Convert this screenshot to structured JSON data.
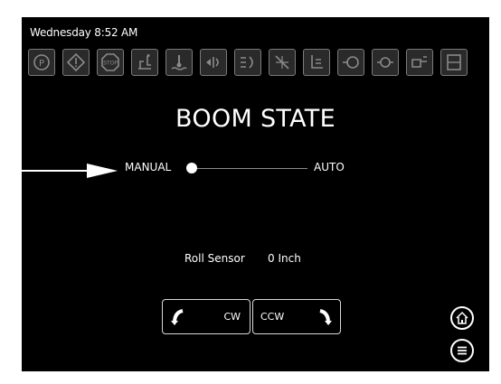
{
  "header": {
    "datetime": "Wednesday 8:52 AM"
  },
  "status_icons": [
    "parking-brake-icon",
    "warning-icon",
    "stop-icon",
    "seat-operator-icon",
    "water-temp-icon",
    "left-turn-icon",
    "hazard-icon",
    "no-fan-icon",
    "hydraulic-icon",
    "right-arrow-gauge-icon",
    "engine-icon",
    "fuel-nozzle-icon",
    "fuel-level-icon"
  ],
  "title": "BOOM STATE",
  "mode": {
    "manual_label": "MANUAL",
    "auto_label": "AUTO",
    "selected": "MANUAL"
  },
  "roll_sensor": {
    "label": "Roll Sensor",
    "value": "0 Inch"
  },
  "buttons": {
    "cw_label": "CW",
    "ccw_label": "CCW"
  },
  "colors": {
    "background": "#000000",
    "foreground": "#ffffff",
    "icon_border": "#7a7a7a"
  }
}
